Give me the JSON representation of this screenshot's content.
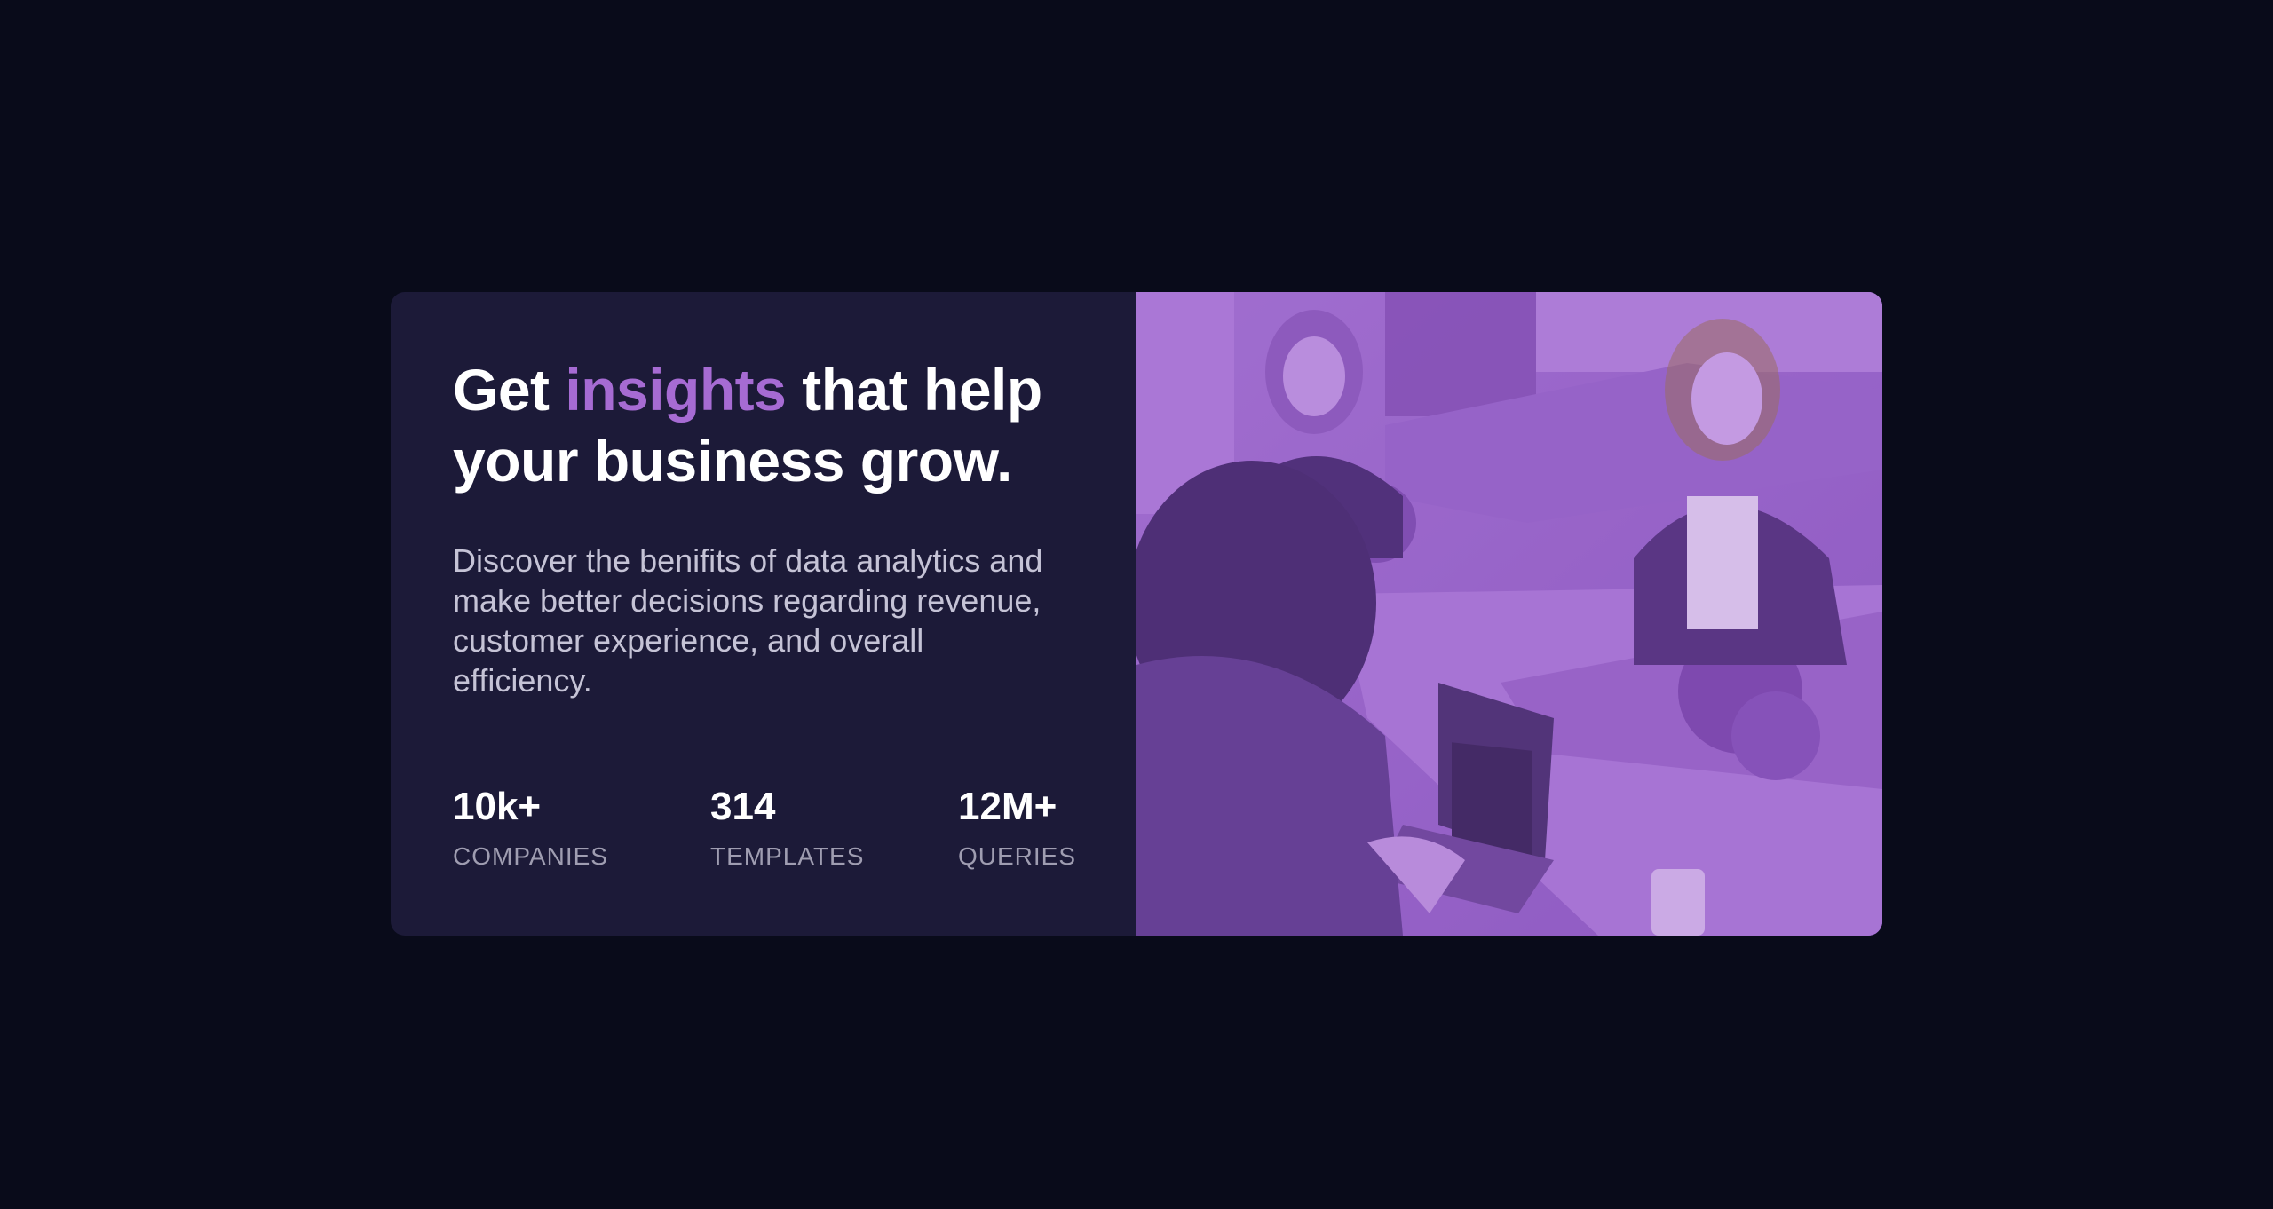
{
  "hero": {
    "heading_before": "Get ",
    "heading_accent": "insights",
    "heading_after": " that help your business grow.",
    "description": "Discover the benifits of data analytics and make better decisions regarding revenue, customer experience, and overall efficiency."
  },
  "stats": [
    {
      "value": "10k+",
      "label": "COMPANIES"
    },
    {
      "value": "314",
      "label": "TEMPLATES"
    },
    {
      "value": "12M+",
      "label": "QUERIES"
    }
  ],
  "colors": {
    "page_background": "#090b1a",
    "card_background": "#1c1a38",
    "accent": "#a66bd3",
    "image_overlay": "#8a55bd"
  }
}
